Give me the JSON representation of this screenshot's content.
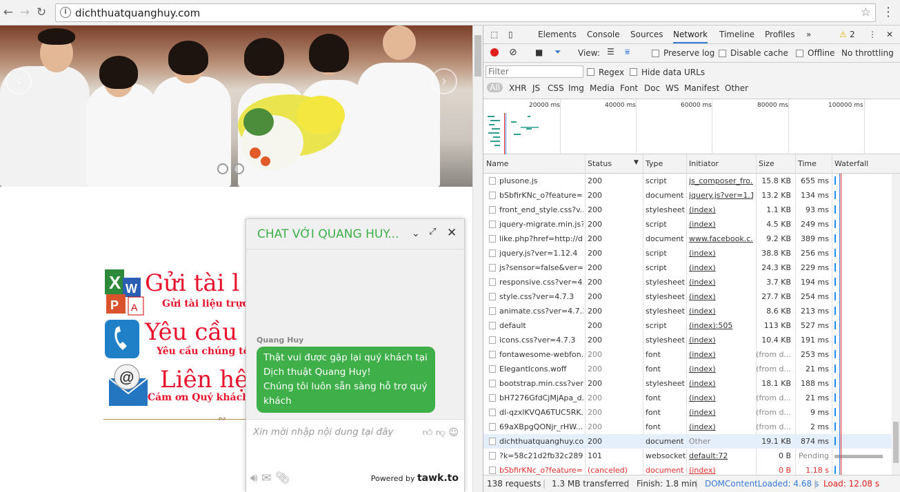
{
  "browser": {
    "url": "dichthuatquanghuy.com"
  },
  "website": {
    "services": [
      {
        "big": "Gửi tài l",
        "small": "Gửi tài liệu trực tu"
      },
      {
        "big": "Yêu cầu",
        "small": "Yêu cầu chúng tôi g"
      },
      {
        "big": "Liên hệ",
        "small": "Cám ơn Quý khách đ"
      }
    ]
  },
  "chat": {
    "title": "CHAT VỚI QUANG HUY...",
    "agent_name": "Quang Huy",
    "message_lines": [
      "Thật vui được gặp lại quý khách tại",
      "Dịch thuật Quang Huy!",
      "Chúng tôi luôn sẵn sàng hỗ trợ quý",
      "khách"
    ],
    "input_placeholder": "Xin mời nhập nội dung tại đây",
    "powered_by": "Powered by",
    "brand": "tawk.to"
  },
  "devtools": {
    "tabs": [
      "Elements",
      "Console",
      "Sources",
      "Network",
      "Timeline",
      "Profiles"
    ],
    "active_tab": "Network",
    "warning_count": "2",
    "view_label": "View:",
    "checkboxes": [
      "Preserve log",
      "Disable cache",
      "Offline"
    ],
    "throttling": "No throttling",
    "filter_placeholder": "Filter",
    "filter_checks": [
      "Regex",
      "Hide data URLs"
    ],
    "types": [
      "All",
      "XHR",
      "JS",
      "CSS",
      "Img",
      "Media",
      "Font",
      "Doc",
      "WS",
      "Manifest",
      "Other"
    ],
    "overview_labels": [
      "20000 ms",
      "40000 ms",
      "60000 ms",
      "80000 ms",
      "100000 ms"
    ],
    "columns": [
      "Name",
      "Status",
      "Type",
      "Initiator",
      "Size",
      "Time",
      "Waterfall"
    ],
    "rows": [
      {
        "name": "plusone.js",
        "status": "200",
        "type": "script",
        "initiator": "js_composer_fro...",
        "size": "15.8 KB",
        "time": "655 ms"
      },
      {
        "name": "bSbfirKNc_o?feature=...",
        "status": "200",
        "type": "document",
        "initiator": "jquery.js?ver=1.1...",
        "size": "13.2 KB",
        "time": "134 ms"
      },
      {
        "name": "front_end_style.css?v...",
        "status": "200",
        "type": "stylesheet",
        "initiator": "(index)",
        "size": "1.1 KB",
        "time": "93 ms"
      },
      {
        "name": "jquery-migrate.min.js?...",
        "status": "200",
        "type": "script",
        "initiator": "(index)",
        "size": "4.5 KB",
        "time": "249 ms"
      },
      {
        "name": "like.php?href=http://d...",
        "status": "200",
        "type": "document",
        "initiator": "www.facebook.c...",
        "size": "9.2 KB",
        "time": "389 ms"
      },
      {
        "name": "jquery.js?ver=1.12.4",
        "status": "200",
        "type": "script",
        "initiator": "(index)",
        "size": "38.8 KB",
        "time": "256 ms"
      },
      {
        "name": "js?sensor=false&ver=4...",
        "status": "200",
        "type": "script",
        "initiator": "(index)",
        "size": "24.3 KB",
        "time": "229 ms"
      },
      {
        "name": "responsive.css?ver=4....",
        "status": "200",
        "type": "stylesheet",
        "initiator": "(index)",
        "size": "3.7 KB",
        "time": "194 ms"
      },
      {
        "name": "style.css?ver=4.7.3",
        "status": "200",
        "type": "stylesheet",
        "initiator": "(index)",
        "size": "27.7 KB",
        "time": "254 ms"
      },
      {
        "name": "animate.css?ver=4.7.3",
        "status": "200",
        "type": "stylesheet",
        "initiator": "(index)",
        "size": "8.6 KB",
        "time": "213 ms"
      },
      {
        "name": "default",
        "status": "200",
        "type": "script",
        "initiator": "(index):505",
        "size": "113 KB",
        "time": "527 ms"
      },
      {
        "name": "icons.css?ver=4.7.3",
        "status": "200",
        "type": "stylesheet",
        "initiator": "(index)",
        "size": "10.4 KB",
        "time": "191 ms"
      },
      {
        "name": "fontawesome-webfon...",
        "status": "200",
        "type": "font",
        "initiator": "(index)",
        "size": "(from d...",
        "time": "253 ms"
      },
      {
        "name": "ElegantIcons.woff",
        "status": "200",
        "type": "font",
        "initiator": "(index)",
        "size": "(from d...",
        "time": "21 ms"
      },
      {
        "name": "bootstrap.min.css?ver...",
        "status": "200",
        "type": "stylesheet",
        "initiator": "(index)",
        "size": "18.1 KB",
        "time": "188 ms"
      },
      {
        "name": "bH7276GfdCjMjApa_d...",
        "status": "200",
        "type": "font",
        "initiator": "(index)",
        "size": "(from d...",
        "time": "21 ms"
      },
      {
        "name": "dl-qzxlKVQA6TUC5RK...",
        "status": "200",
        "type": "font",
        "initiator": "(index)",
        "size": "(from d...",
        "time": "9 ms"
      },
      {
        "name": "69aXBpgQONjr_rHW...",
        "status": "200",
        "type": "font",
        "initiator": "(index)",
        "size": "(from d...",
        "time": "2 ms"
      },
      {
        "name": "dichthuatquanghuy.co...",
        "status": "200",
        "type": "document",
        "initiator": "Other",
        "size": "19.1 KB",
        "time": "874 ms"
      },
      {
        "name": "?k=58c21d2fb32c289f...",
        "status": "101",
        "type": "websocket",
        "initiator": "default:72",
        "size": "0 B",
        "time": "Pending"
      },
      {
        "name": "bSbfirKNc_o?feature=...",
        "status": "(canceled)",
        "type": "document",
        "initiator": "(index)",
        "size": "0 B",
        "time": "1.18 s"
      }
    ],
    "status_bar": {
      "requests": "138 requests",
      "transferred": "1.3 MB transferred",
      "finish": "Finish: 1.8 min",
      "dcl": "DOMContentLoaded: 4.68 s",
      "load": "Load: 12.08 s"
    }
  }
}
